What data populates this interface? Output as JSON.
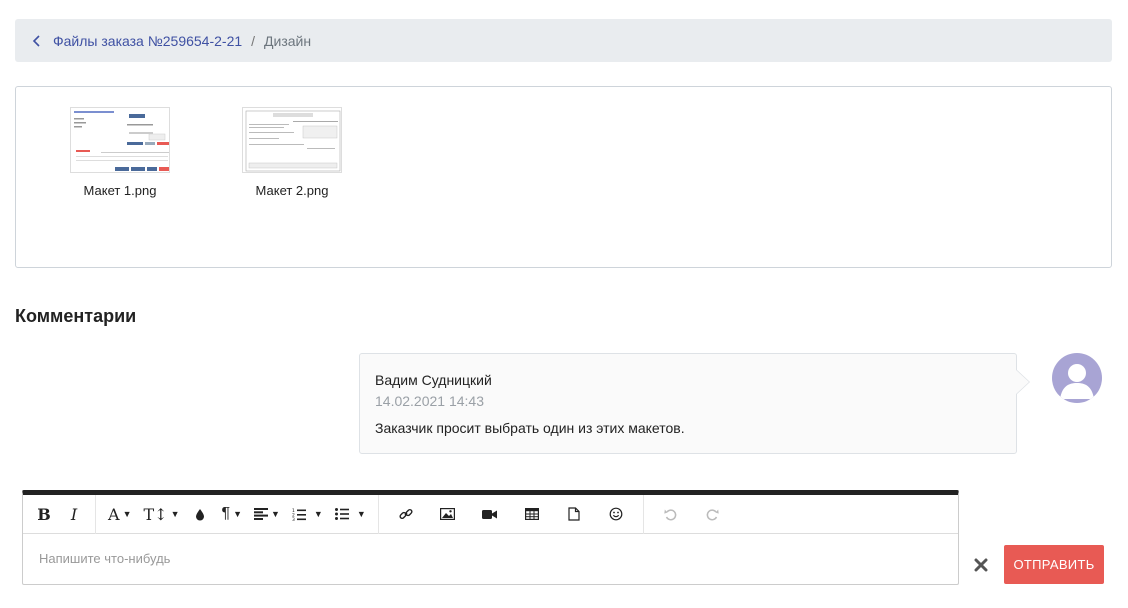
{
  "breadcrumb": {
    "parent_label": "Файлы заказа №259654-2-21",
    "separator": "/",
    "current_label": "Дизайн"
  },
  "files": [
    {
      "name": "Макет 1.png",
      "icon": "image-thumbnail"
    },
    {
      "name": "Макет 2.png",
      "icon": "image-thumbnail"
    }
  ],
  "comments": {
    "title": "Комментарии",
    "items": [
      {
        "author": "Вадим Судницкий",
        "timestamp": "14.02.2021 14:43",
        "text": "Заказчик просит выбрать один из этих макетов.",
        "avatar_icon": "user-silhouette-icon"
      }
    ]
  },
  "editor": {
    "placeholder": "Напишите что-нибудь",
    "value": "",
    "toolbar": [
      "bold",
      "italic",
      "font-family",
      "font-size",
      "text-color",
      "paragraph-format",
      "align",
      "ordered-list",
      "unordered-list",
      "insert-link",
      "insert-image",
      "insert-video",
      "insert-table",
      "insert-file",
      "emoticons",
      "undo",
      "redo"
    ]
  },
  "actions": {
    "send_label": "ОТПРАВИТЬ",
    "clear_icon": "close-icon"
  },
  "colors": {
    "accent_link": "#3f51a3",
    "send_button": "#e85a54",
    "breadcrumb_bg": "#e9ecef",
    "avatar_bg": "#a8a4d4"
  }
}
